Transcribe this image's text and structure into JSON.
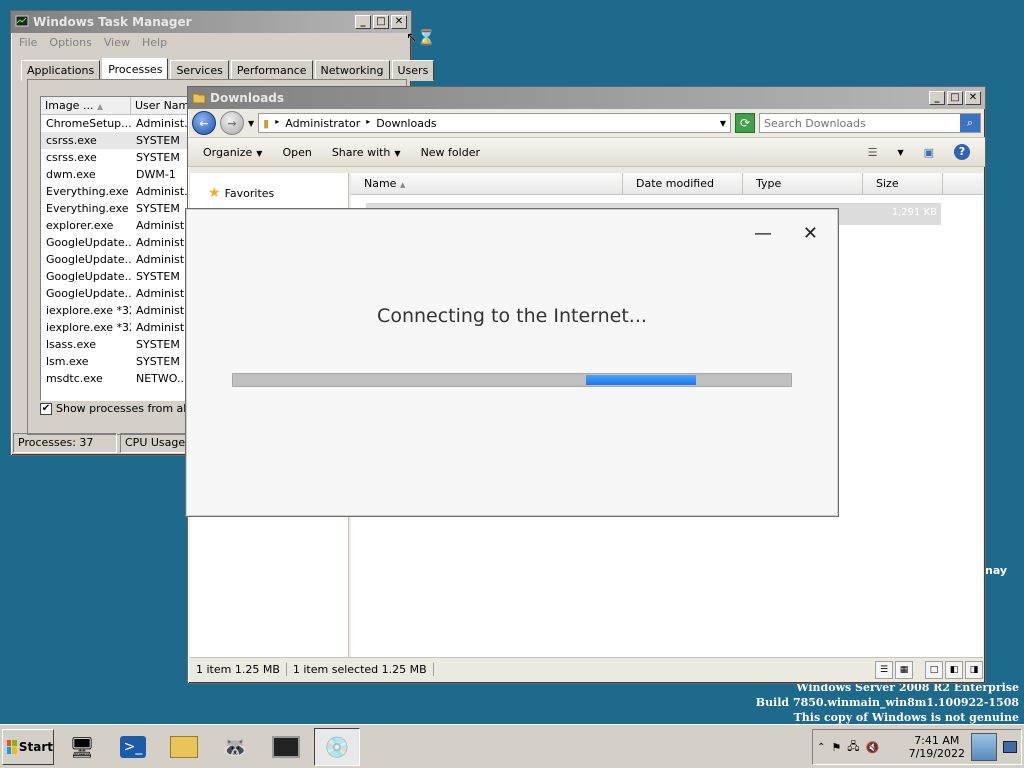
{
  "desktop": {
    "watermark_lines": [
      "Windows Server 2008 R2 Enterprise",
      "Build 7850.winmain_win8m1.100922-1508",
      "This copy of Windows is not genuine"
    ],
    "edge_text": "nay"
  },
  "taskmgr": {
    "title": "Windows Task Manager",
    "menu": [
      "File",
      "Options",
      "View",
      "Help"
    ],
    "tabs": [
      "Applications",
      "Processes",
      "Services",
      "Performance",
      "Networking",
      "Users"
    ],
    "active_tab": 1,
    "columns": [
      "Image ...",
      "User Name"
    ],
    "processes": [
      {
        "image": "ChromeSetup....",
        "user": "Administ..."
      },
      {
        "image": "csrss.exe",
        "user": "SYSTEM"
      },
      {
        "image": "csrss.exe",
        "user": "SYSTEM"
      },
      {
        "image": "dwm.exe",
        "user": "DWM-1"
      },
      {
        "image": "Everything.exe",
        "user": "Administ..."
      },
      {
        "image": "Everything.exe",
        "user": "SYSTEM"
      },
      {
        "image": "explorer.exe",
        "user": "Administ..."
      },
      {
        "image": "GoogleUpdate...",
        "user": "Administ..."
      },
      {
        "image": "GoogleUpdate...",
        "user": "Administ..."
      },
      {
        "image": "GoogleUpdate...",
        "user": "SYSTEM"
      },
      {
        "image": "GoogleUpdate...",
        "user": "Administ..."
      },
      {
        "image": "iexplore.exe *32",
        "user": "Administ..."
      },
      {
        "image": "iexplore.exe *32",
        "user": "Administ..."
      },
      {
        "image": "lsass.exe",
        "user": "SYSTEM"
      },
      {
        "image": "lsm.exe",
        "user": "SYSTEM"
      },
      {
        "image": "msdtc.exe",
        "user": "NETWO..."
      }
    ],
    "selected_row": 1,
    "show_all_label": "Show processes from all us",
    "show_all_checked": true,
    "status_processes": "Processes: 37",
    "status_cpu": "CPU Usage:"
  },
  "explorer": {
    "title": "Downloads",
    "breadcrumb": [
      "Administrator",
      "Downloads"
    ],
    "search_placeholder": "Search Downloads",
    "commands": [
      "Organize",
      "Open",
      "Share with",
      "New folder"
    ],
    "nav_favorites": "Favorites",
    "columns": [
      "Name",
      "Date modified",
      "Type",
      "Size"
    ],
    "file_size": "1,291 KB",
    "status_items": "1 item  1.25 MB",
    "status_selected": "1 item selected  1.25 MB"
  },
  "installer": {
    "message": "Connecting to the Internet...",
    "minimize_glyph": "—",
    "close_glyph": "✕"
  },
  "taskbar": {
    "start_label": "Start",
    "clock_time": "7:41 AM",
    "clock_date": "7/19/2022"
  },
  "colors": {
    "desktop": "#1e6a8c",
    "progress_fill": "#1a78e6"
  }
}
